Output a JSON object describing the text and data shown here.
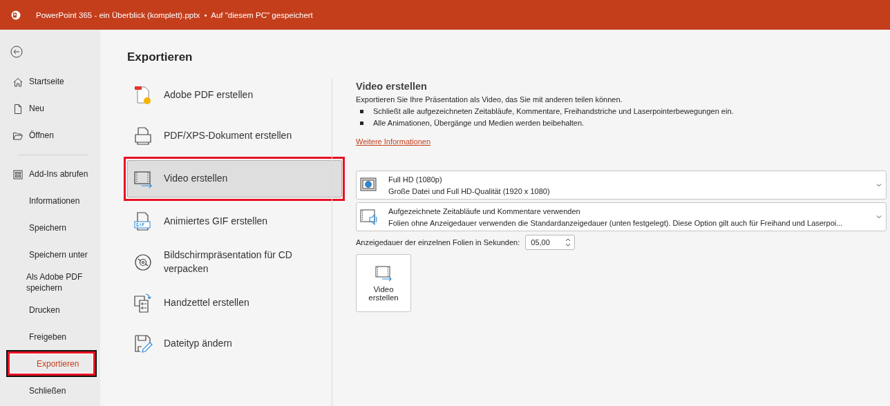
{
  "title_bar": {
    "title": "PowerPoint 365 - ein Überblick (komplett).pptx  •  Auf \"diesem PC\" gespeichert"
  },
  "sidebar": {
    "groups": [
      [
        {
          "label": "Startseite",
          "selected": false,
          "highlighted": false
        },
        {
          "label": "Neu",
          "selected": false,
          "highlighted": false
        },
        {
          "label": "Öffnen",
          "selected": false,
          "highlighted": false
        }
      ],
      [
        {
          "label": "Add-Ins abrufen",
          "selected": false,
          "highlighted": false
        },
        {
          "label": "Informationen",
          "selected": false,
          "highlighted": false
        },
        {
          "label": "Speichern",
          "selected": false,
          "highlighted": false
        },
        {
          "label": "Speichern unter",
          "selected": false,
          "highlighted": false
        },
        {
          "label": "Als Adobe PDF speichern",
          "selected": false,
          "highlighted": false
        },
        {
          "label": "Drucken",
          "selected": false,
          "highlighted": false
        },
        {
          "label": "Freigeben",
          "selected": false,
          "highlighted": false
        },
        {
          "label": "Exportieren",
          "selected": true,
          "highlighted": true
        },
        {
          "label": "Schließen",
          "selected": false,
          "highlighted": false
        }
      ]
    ]
  },
  "page_title": "Exportieren",
  "export_options": [
    {
      "label": "Adobe PDF erstellen",
      "selected": false,
      "highlighted": false
    },
    {
      "label": "PDF/XPS-Dokument erstellen",
      "selected": false,
      "highlighted": false
    },
    {
      "label": "Video erstellen",
      "selected": true,
      "highlighted": true
    },
    {
      "label": "Animiertes GIF erstellen",
      "selected": false,
      "highlighted": false
    },
    {
      "label": "Bildschirmpräsentation für CD verpacken",
      "selected": false,
      "highlighted": false
    },
    {
      "label": "Handzettel erstellen",
      "selected": false,
      "highlighted": false
    },
    {
      "label": "Dateityp ändern",
      "selected": false,
      "highlighted": false
    }
  ],
  "detail": {
    "title": "Video erstellen",
    "description": "Exportieren Sie Ihre Präsentation als Video, das Sie mit anderen teilen können.",
    "bullets": [
      "Schließt alle aufgezeichneten Zeitabläufe, Kommentare, Freihandstriche und Laserpointerbewegungen ein.",
      "Alle Animationen, Übergänge und Medien werden beibehalten."
    ],
    "link": "Weitere Informationen",
    "dropdowns": [
      {
        "title": "Full HD (1080p)",
        "subtitle": "Große Datei und Full HD-Qualität (1920 x 1080)"
      },
      {
        "title": "Aufgezeichnete Zeitabläufe und Kommentare verwenden",
        "subtitle": "Folien ohne Anzeigedauer verwenden die Standardanzeigedauer (unten festgelegt). Diese Option gilt auch für Freihand und Laserpoi..."
      }
    ],
    "duration": {
      "label": "Anzeigedauer der einzelnen Folien in Sekunden:",
      "value": "05,00"
    },
    "create_button": {
      "label": "Video erstellen"
    }
  }
}
